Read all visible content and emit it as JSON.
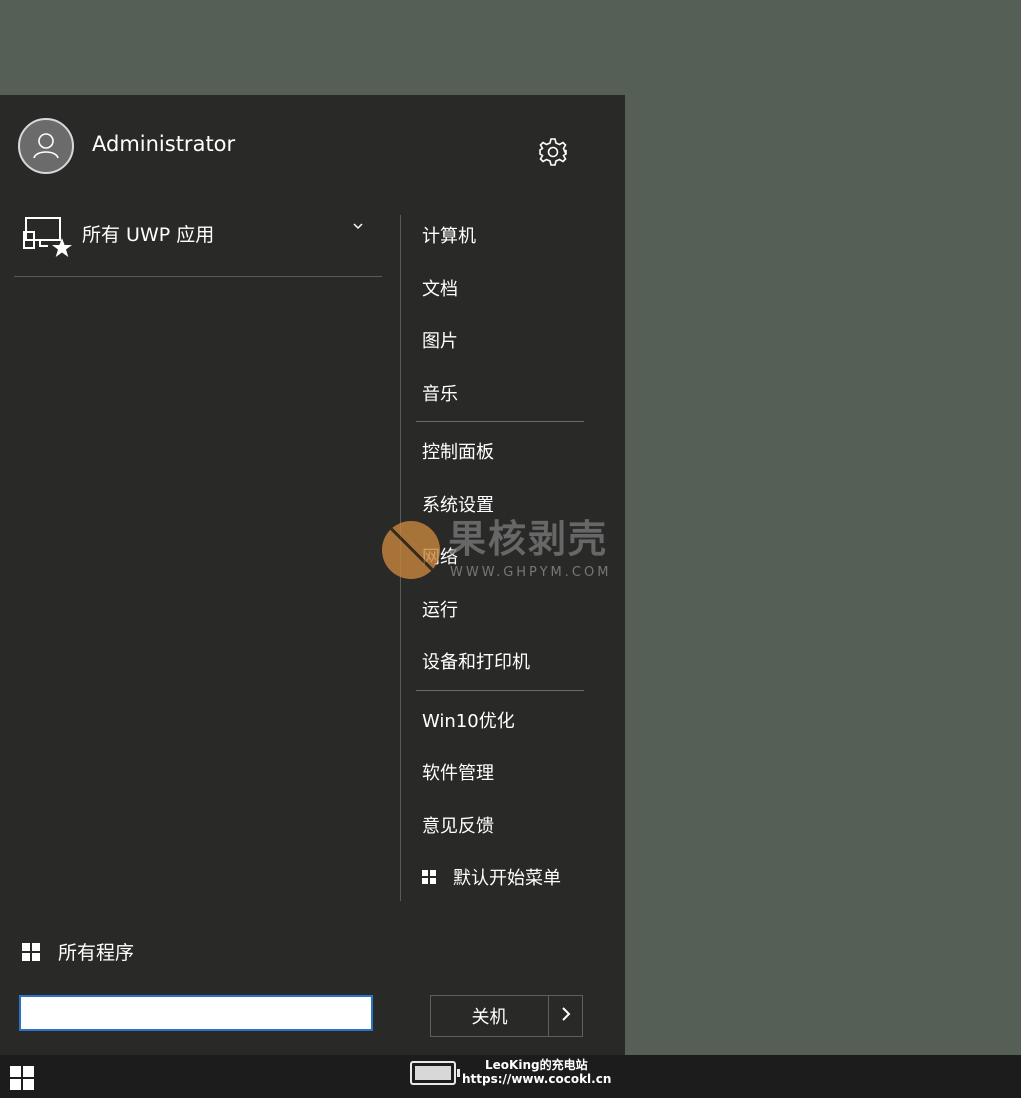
{
  "user": {
    "name": "Administrator"
  },
  "uwp": {
    "label": "所有 UWP 应用"
  },
  "right_menu": {
    "group1": [
      "计算机",
      "文档",
      "图片",
      "音乐"
    ],
    "group2": [
      "控制面板",
      "系统设置",
      "网络",
      "运行",
      "设备和打印机"
    ],
    "group3": [
      "Win10优化",
      "软件管理",
      "意见反馈"
    ],
    "default_menu": "默认开始菜单"
  },
  "all_programs": {
    "label": "所有程序"
  },
  "search": {
    "value": "",
    "placeholder": ""
  },
  "shutdown": {
    "label": "关机",
    "arrow": ">"
  },
  "taskbar": {
    "line1": "LeoKing的充电站",
    "line2": "https://www.cocokl.cn"
  },
  "watermark": {
    "title": "果核剥壳",
    "url": "WWW.GHPYM.COM"
  },
  "colors": {
    "menu_bg": "#292a28",
    "desktop": "#565f56",
    "taskbar": "#1b1c1b",
    "search_border": "#2b73c9"
  }
}
